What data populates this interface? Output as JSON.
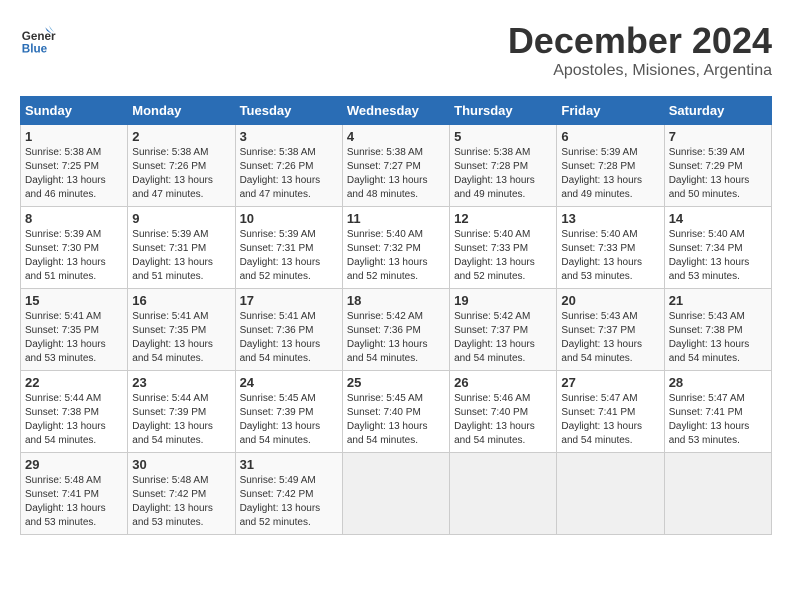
{
  "header": {
    "logo_line1": "General",
    "logo_line2": "Blue",
    "month": "December 2024",
    "location": "Apostoles, Misiones, Argentina"
  },
  "weekdays": [
    "Sunday",
    "Monday",
    "Tuesday",
    "Wednesday",
    "Thursday",
    "Friday",
    "Saturday"
  ],
  "weeks": [
    [
      {
        "day": 1,
        "sunrise": "5:38 AM",
        "sunset": "7:25 PM",
        "daylight": "13 hours and 46 minutes."
      },
      {
        "day": 2,
        "sunrise": "5:38 AM",
        "sunset": "7:26 PM",
        "daylight": "13 hours and 47 minutes."
      },
      {
        "day": 3,
        "sunrise": "5:38 AM",
        "sunset": "7:26 PM",
        "daylight": "13 hours and 47 minutes."
      },
      {
        "day": 4,
        "sunrise": "5:38 AM",
        "sunset": "7:27 PM",
        "daylight": "13 hours and 48 minutes."
      },
      {
        "day": 5,
        "sunrise": "5:38 AM",
        "sunset": "7:28 PM",
        "daylight": "13 hours and 49 minutes."
      },
      {
        "day": 6,
        "sunrise": "5:39 AM",
        "sunset": "7:28 PM",
        "daylight": "13 hours and 49 minutes."
      },
      {
        "day": 7,
        "sunrise": "5:39 AM",
        "sunset": "7:29 PM",
        "daylight": "13 hours and 50 minutes."
      }
    ],
    [
      {
        "day": 8,
        "sunrise": "5:39 AM",
        "sunset": "7:30 PM",
        "daylight": "13 hours and 51 minutes."
      },
      {
        "day": 9,
        "sunrise": "5:39 AM",
        "sunset": "7:31 PM",
        "daylight": "13 hours and 51 minutes."
      },
      {
        "day": 10,
        "sunrise": "5:39 AM",
        "sunset": "7:31 PM",
        "daylight": "13 hours and 52 minutes."
      },
      {
        "day": 11,
        "sunrise": "5:40 AM",
        "sunset": "7:32 PM",
        "daylight": "13 hours and 52 minutes."
      },
      {
        "day": 12,
        "sunrise": "5:40 AM",
        "sunset": "7:33 PM",
        "daylight": "13 hours and 52 minutes."
      },
      {
        "day": 13,
        "sunrise": "5:40 AM",
        "sunset": "7:33 PM",
        "daylight": "13 hours and 53 minutes."
      },
      {
        "day": 14,
        "sunrise": "5:40 AM",
        "sunset": "7:34 PM",
        "daylight": "13 hours and 53 minutes."
      }
    ],
    [
      {
        "day": 15,
        "sunrise": "5:41 AM",
        "sunset": "7:35 PM",
        "daylight": "13 hours and 53 minutes."
      },
      {
        "day": 16,
        "sunrise": "5:41 AM",
        "sunset": "7:35 PM",
        "daylight": "13 hours and 54 minutes."
      },
      {
        "day": 17,
        "sunrise": "5:41 AM",
        "sunset": "7:36 PM",
        "daylight": "13 hours and 54 minutes."
      },
      {
        "day": 18,
        "sunrise": "5:42 AM",
        "sunset": "7:36 PM",
        "daylight": "13 hours and 54 minutes."
      },
      {
        "day": 19,
        "sunrise": "5:42 AM",
        "sunset": "7:37 PM",
        "daylight": "13 hours and 54 minutes."
      },
      {
        "day": 20,
        "sunrise": "5:43 AM",
        "sunset": "7:37 PM",
        "daylight": "13 hours and 54 minutes."
      },
      {
        "day": 21,
        "sunrise": "5:43 AM",
        "sunset": "7:38 PM",
        "daylight": "13 hours and 54 minutes."
      }
    ],
    [
      {
        "day": 22,
        "sunrise": "5:44 AM",
        "sunset": "7:38 PM",
        "daylight": "13 hours and 54 minutes."
      },
      {
        "day": 23,
        "sunrise": "5:44 AM",
        "sunset": "7:39 PM",
        "daylight": "13 hours and 54 minutes."
      },
      {
        "day": 24,
        "sunrise": "5:45 AM",
        "sunset": "7:39 PM",
        "daylight": "13 hours and 54 minutes."
      },
      {
        "day": 25,
        "sunrise": "5:45 AM",
        "sunset": "7:40 PM",
        "daylight": "13 hours and 54 minutes."
      },
      {
        "day": 26,
        "sunrise": "5:46 AM",
        "sunset": "7:40 PM",
        "daylight": "13 hours and 54 minutes."
      },
      {
        "day": 27,
        "sunrise": "5:47 AM",
        "sunset": "7:41 PM",
        "daylight": "13 hours and 54 minutes."
      },
      {
        "day": 28,
        "sunrise": "5:47 AM",
        "sunset": "7:41 PM",
        "daylight": "13 hours and 53 minutes."
      }
    ],
    [
      {
        "day": 29,
        "sunrise": "5:48 AM",
        "sunset": "7:41 PM",
        "daylight": "13 hours and 53 minutes."
      },
      {
        "day": 30,
        "sunrise": "5:48 AM",
        "sunset": "7:42 PM",
        "daylight": "13 hours and 53 minutes."
      },
      {
        "day": 31,
        "sunrise": "5:49 AM",
        "sunset": "7:42 PM",
        "daylight": "13 hours and 52 minutes."
      },
      null,
      null,
      null,
      null
    ]
  ]
}
